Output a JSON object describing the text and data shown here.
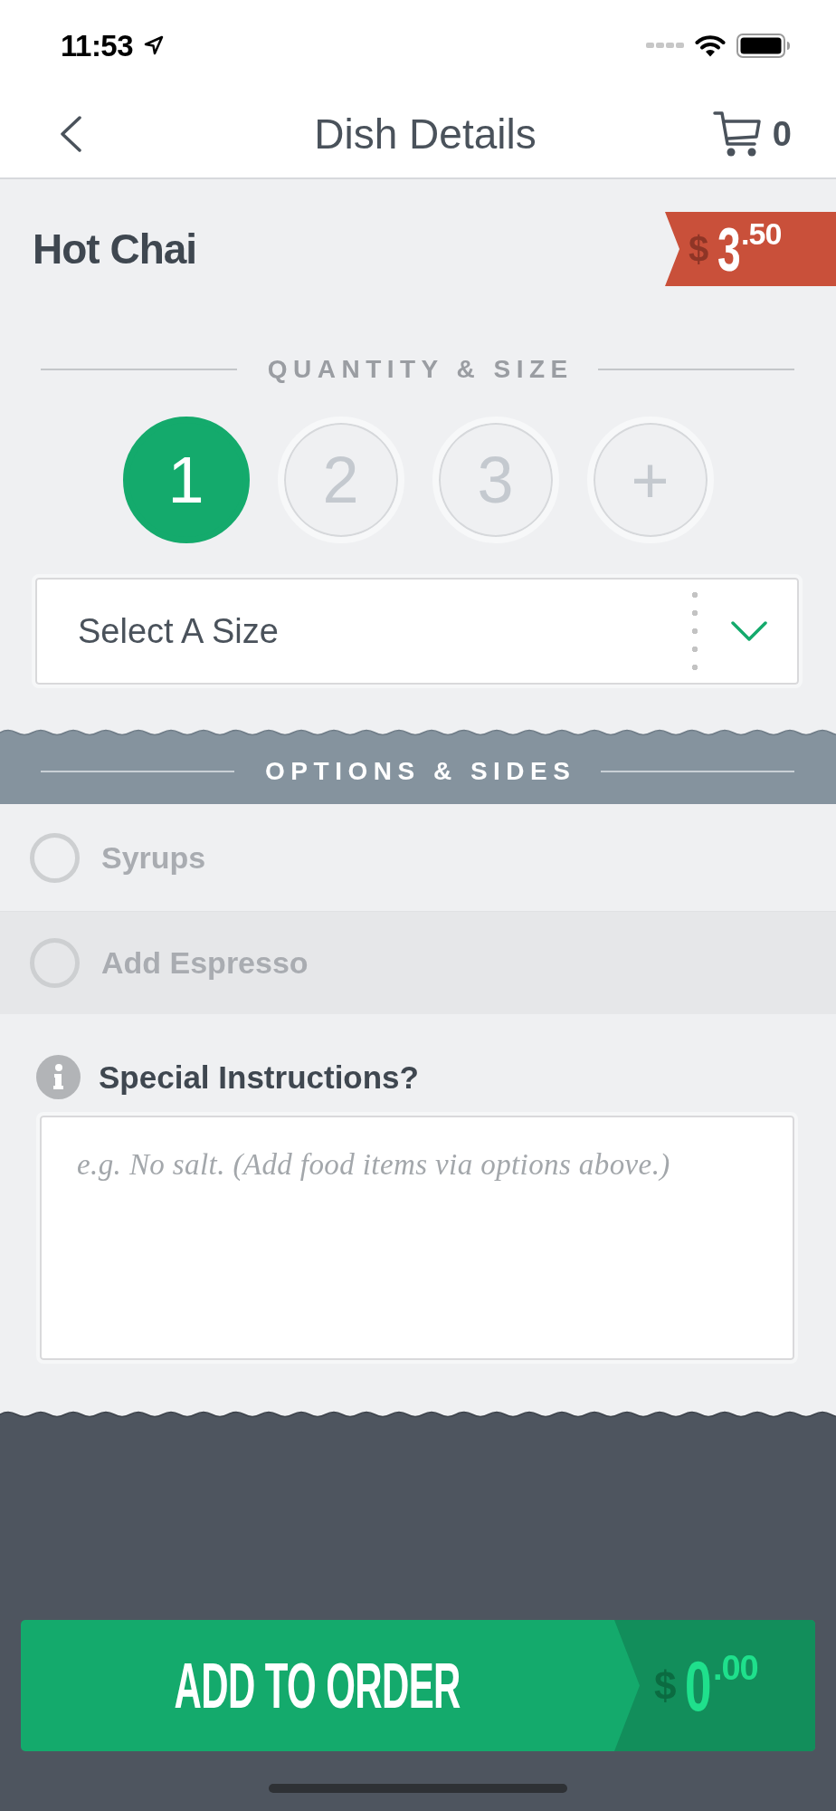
{
  "status_bar": {
    "time": "11:53"
  },
  "header": {
    "title": "Dish Details",
    "cart_count": "0"
  },
  "dish": {
    "name": "Hot Chai",
    "price": {
      "currency": "$",
      "whole": "3",
      "fraction": ".50"
    }
  },
  "quantity_section": {
    "heading": "QUANTITY & SIZE",
    "quantities": [
      {
        "label": "1",
        "selected": true
      },
      {
        "label": "2",
        "selected": false
      },
      {
        "label": "3",
        "selected": false
      },
      {
        "label": "+",
        "selected": false
      }
    ],
    "size_select": {
      "prompt": "Select A Size"
    }
  },
  "options_section": {
    "heading": "OPTIONS & SIDES",
    "options": [
      {
        "label": "Syrups",
        "checked": false
      },
      {
        "label": "Add Espresso",
        "checked": false
      }
    ]
  },
  "special_instructions": {
    "label": "Special Instructions?",
    "placeholder": "e.g. No salt. (Add food items via options above.)"
  },
  "add_to_order": {
    "label": "ADD TO ORDER",
    "total": {
      "currency": "$",
      "whole": "0",
      "fraction": ".00"
    }
  }
}
